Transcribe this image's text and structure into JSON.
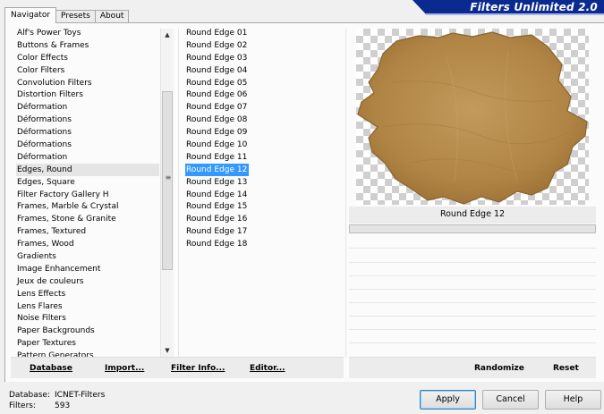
{
  "tabs": [
    {
      "label": "Navigator",
      "active": true
    },
    {
      "label": "Presets",
      "active": false
    },
    {
      "label": "About",
      "active": false
    }
  ],
  "banner": {
    "title": "Filters Unlimited 2.0"
  },
  "categories": [
    "Alf's Power Toys",
    "Buttons & Frames",
    "Color Effects",
    "Color Filters",
    "Convolution Filters",
    "Distortion Filters",
    "Déformation",
    "Déformations",
    "Déformations",
    "Déformations",
    "Déformation",
    "Edges, Round",
    "Edges, Square",
    "Filter Factory Gallery H",
    "Frames, Marble & Crystal",
    "Frames, Stone & Granite",
    "Frames, Textured",
    "Frames, Wood",
    "Gradients",
    "Image Enhancement",
    "Jeux de couleurs",
    "Lens Effects",
    "Lens Flares",
    "Noise Filters",
    "Paper Backgrounds",
    "Paper Textures",
    "Pattern Generators"
  ],
  "selected_category": "Edges, Round",
  "filters": [
    "Round Edge 01",
    "Round Edge 02",
    "Round Edge 03",
    "Round Edge 04",
    "Round Edge 05",
    "Round Edge 06",
    "Round Edge 07",
    "Round Edge 08",
    "Round Edge 09",
    "Round Edge 10",
    "Round Edge 11",
    "Round Edge 12",
    "Round Edge 13",
    "Round Edge 14",
    "Round Edge 15",
    "Round Edge 16",
    "Round Edge 17",
    "Round Edge 18"
  ],
  "selected_filter": "Round Edge 12",
  "preview": {
    "title": "Round Edge 12",
    "progress": 0
  },
  "toolbar": {
    "database": "Database",
    "import": "Import...",
    "filter_info": "Filter Info...",
    "editor": "Editor...",
    "randomize": "Randomize",
    "reset": "Reset"
  },
  "status": {
    "database_label": "Database:",
    "database_value": "ICNET-Filters",
    "filters_label": "Filters:",
    "filters_value": "593"
  },
  "buttons": {
    "apply": "Apply",
    "cancel": "Cancel",
    "help": "Help"
  },
  "colors": {
    "selection": "#3399ff",
    "banner": "#0a2a8f",
    "paper": "#b5894a"
  }
}
